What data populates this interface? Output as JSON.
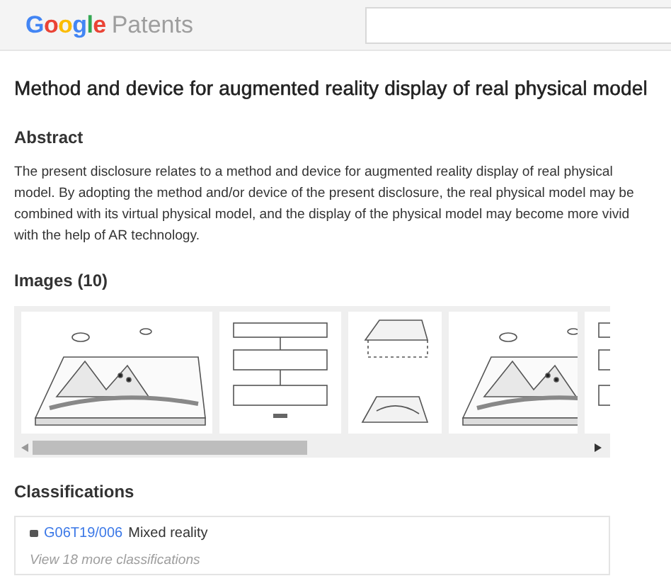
{
  "header": {
    "logo": {
      "brand": "Google",
      "product": "Patents"
    }
  },
  "title": "Method and device for augmented reality display of real physical model",
  "abstract": {
    "heading": "Abstract",
    "text": "The present disclosure relates to a method and device for augmented reality display of real physical model. By adopting the method and/or device of the present disclosure, the real physical model may be combined with its virtual physical model, and the display of the physical model may become more vivid with the help of AR technology."
  },
  "images": {
    "heading": "Images (10)"
  },
  "classifications": {
    "heading": "Classifications",
    "items": [
      {
        "code": "G06T19/006",
        "label": "Mixed reality"
      }
    ],
    "more": "View 18 more classifications"
  }
}
